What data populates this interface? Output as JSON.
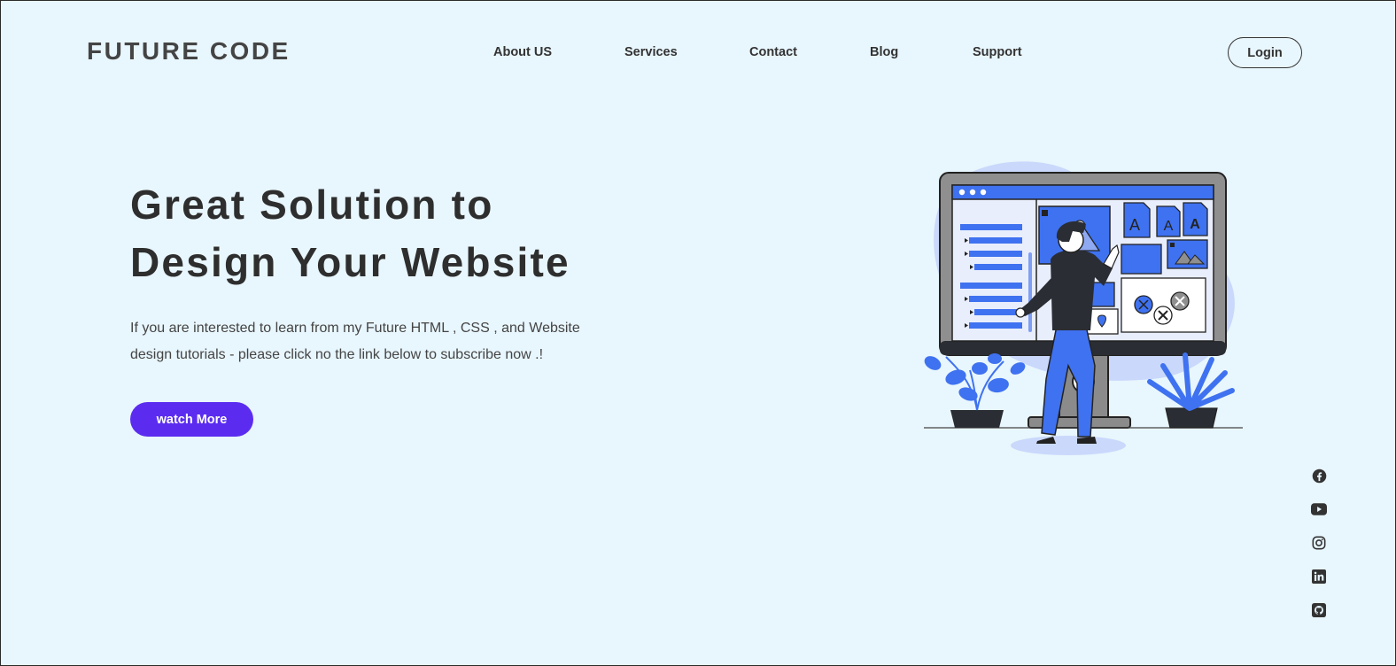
{
  "brand": {
    "logo": "FUTURE CODE"
  },
  "nav": {
    "items": [
      "About US",
      "Services",
      "Contact",
      "Blog",
      "Support"
    ],
    "login_label": "Login"
  },
  "hero": {
    "title_line1": "Great Solution to",
    "title_line2": "Design Your Website",
    "description": "If you are interested to learn from my Future HTML , CSS , and Website design tutorials - please click no the link below to subscribe now .!",
    "cta_label": "watch More"
  },
  "social": {
    "icons": [
      "facebook-icon",
      "youtube-icon",
      "instagram-icon",
      "linkedin-icon",
      "github-icon"
    ]
  },
  "colors": {
    "background": "#e8f6fd",
    "accent": "#5b2cf0",
    "illustration_blue": "#3f72f0",
    "text": "#333333"
  }
}
